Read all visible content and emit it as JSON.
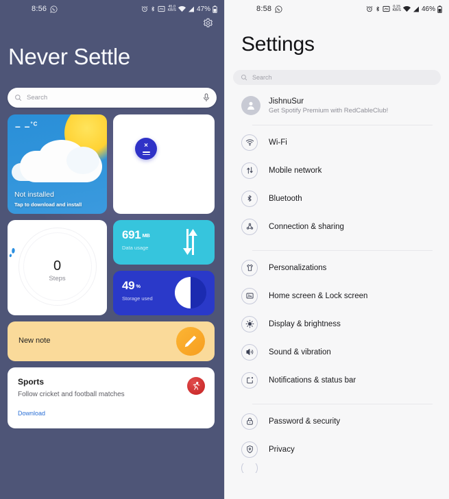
{
  "home": {
    "status_bar": {
      "time": "8:56",
      "whatsapp_icon": "whatsapp-icon",
      "alarm_icon": "alarm-icon",
      "bluetooth_icon": "bluetooth-icon",
      "screenshot_icon": "screenshot-icon",
      "data_speed": "45.0",
      "data_speed_unit": "KB/S",
      "wifi_icon": "wifi-icon",
      "signal_icon": "cellular-signal-icon",
      "battery_percent": "47%",
      "battery_icon": "battery-icon"
    },
    "settings_gear_icon": "gear-icon",
    "title": "Never Settle",
    "search": {
      "placeholder": "Search",
      "search_icon": "search-icon",
      "mic_icon": "microphone-icon"
    },
    "widgets": {
      "weather": {
        "temperature": "– –",
        "unit": "°C",
        "status": "Not installed",
        "action": "Tap to download and install"
      },
      "calculator": {
        "icon": "calculator-icon",
        "multiply_glyph": "×",
        "equals_glyph": "="
      },
      "steps": {
        "icon": "footprint-icon",
        "value": "0",
        "label": "Steps"
      },
      "data_usage": {
        "value": "691",
        "unit": "MB",
        "label": "Data usage",
        "icon": "data-transfer-arrows-icon"
      },
      "storage": {
        "value": "49",
        "unit": "%",
        "label": "Storage used",
        "icon": "pie-chart-icon"
      },
      "note": {
        "label": "New note",
        "icon": "pencil-icon"
      },
      "sports": {
        "title": "Sports",
        "subtitle": "Follow cricket and football matches",
        "download_label": "Download",
        "icon": "running-person-icon"
      }
    }
  },
  "settings": {
    "status_bar": {
      "time": "8:58",
      "whatsapp_icon": "whatsapp-icon",
      "alarm_icon": "alarm-icon",
      "bluetooth_icon": "bluetooth-icon",
      "screenshot_icon": "screenshot-icon",
      "data_speed": "0.15",
      "data_speed_unit": "KB/S",
      "wifi_icon": "wifi-icon",
      "signal_icon": "cellular-signal-icon",
      "battery_percent": "46%",
      "battery_icon": "battery-icon"
    },
    "title": "Settings",
    "search": {
      "placeholder": "Search",
      "search_icon": "search-icon"
    },
    "account": {
      "name": "JishnuSur",
      "subtitle": "Get Spotify Premium with RedCableClub!",
      "avatar_icon": "person-avatar-icon"
    },
    "groups": [
      {
        "items": [
          {
            "label": "Wi-Fi",
            "icon": "wifi-icon"
          },
          {
            "label": "Mobile network",
            "icon": "mobile-network-icon"
          },
          {
            "label": "Bluetooth",
            "icon": "bluetooth-icon"
          },
          {
            "label": "Connection & sharing",
            "icon": "connection-sharing-icon"
          }
        ]
      },
      {
        "items": [
          {
            "label": "Personalizations",
            "icon": "personalizations-icon"
          },
          {
            "label": "Home screen & Lock screen",
            "icon": "home-lock-screen-icon"
          },
          {
            "label": "Display & brightness",
            "icon": "brightness-icon"
          },
          {
            "label": "Sound & vibration",
            "icon": "sound-icon"
          },
          {
            "label": "Notifications & status bar",
            "icon": "notifications-icon"
          }
        ]
      },
      {
        "items": [
          {
            "label": "Password & security",
            "icon": "lock-icon"
          },
          {
            "label": "Privacy",
            "icon": "privacy-shield-icon"
          }
        ]
      }
    ]
  },
  "colors": {
    "home_background": "#4e5577",
    "settings_background": "#f7f7f8",
    "accent_blue": "#2a39c9",
    "cyan": "#36c5dd",
    "note_yellow": "#fada9a",
    "sports_red": "#c52222",
    "link_blue": "#2a6fd6"
  }
}
